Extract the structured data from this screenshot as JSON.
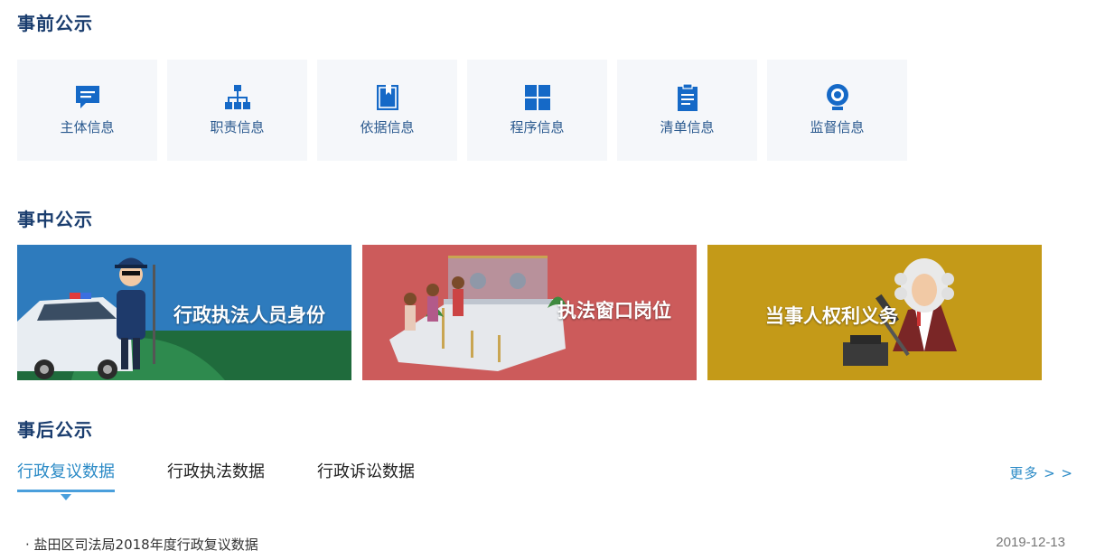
{
  "sections": {
    "before": "事前公示",
    "during": "事中公示",
    "after": "事后公示"
  },
  "cards": [
    {
      "label": "主体信息",
      "icon": "chat-icon"
    },
    {
      "label": "职责信息",
      "icon": "org-chart-icon"
    },
    {
      "label": "依据信息",
      "icon": "book-icon"
    },
    {
      "label": "程序信息",
      "icon": "grid-icon"
    },
    {
      "label": "清单信息",
      "icon": "clipboard-icon"
    },
    {
      "label": "监督信息",
      "icon": "webcam-icon"
    }
  ],
  "banners": [
    {
      "label": "行政执法人员身份",
      "color": "#2e7bbd"
    },
    {
      "label": "执法窗口岗位",
      "color": "#cc5b5b"
    },
    {
      "label": "当事人权利义务",
      "color": "#c49a18"
    }
  ],
  "tabs": [
    {
      "label": "行政复议数据",
      "active": true
    },
    {
      "label": "行政执法数据",
      "active": false
    },
    {
      "label": "行政诉讼数据",
      "active": false
    }
  ],
  "more_label": "更多 > >",
  "list": [
    {
      "title": "· 盐田区司法局2018年度行政复议数据",
      "date": "2019-12-13"
    }
  ],
  "colors": {
    "icon": "#1569c7",
    "title": "#1a3d6e",
    "accent": "#4a9fdc"
  }
}
